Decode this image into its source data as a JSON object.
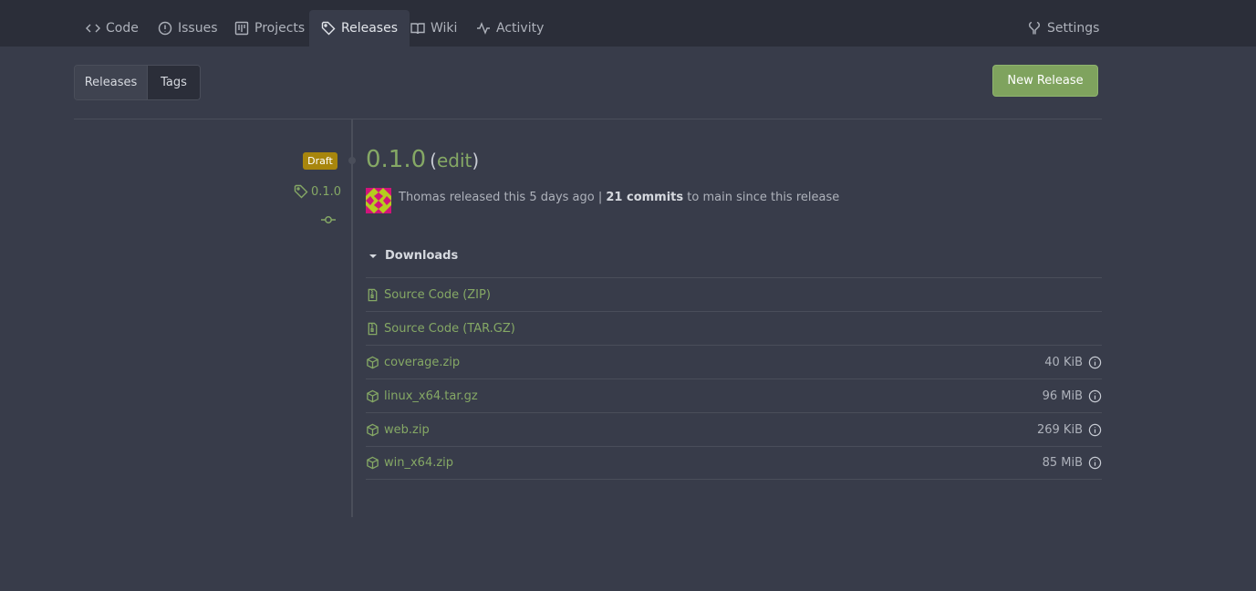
{
  "nav": {
    "tabs": [
      {
        "label": "Code",
        "icon": "code-icon"
      },
      {
        "label": "Issues",
        "icon": "issue-icon"
      },
      {
        "label": "Projects",
        "icon": "project-icon"
      },
      {
        "label": "Releases",
        "icon": "tag-icon",
        "active": true
      },
      {
        "label": "Wiki",
        "icon": "book-icon"
      },
      {
        "label": "Activity",
        "icon": "pulse-icon"
      }
    ],
    "settings_label": "Settings"
  },
  "segment": {
    "releases_label": "Releases",
    "tags_label": "Tags"
  },
  "new_release_label": "New Release",
  "release": {
    "badge": "Draft",
    "tag": "0.1.0",
    "title": "0.1.0",
    "edit_label": "edit",
    "author": "Thomas",
    "released_text": "released this 5 days ago |",
    "commits_count": "21 commits",
    "commits_suffix": "to main since this release"
  },
  "downloads": {
    "label": "Downloads",
    "items": [
      {
        "name": "Source Code (ZIP)",
        "icon": "file-zip-icon",
        "size": ""
      },
      {
        "name": "Source Code (TAR.GZ)",
        "icon": "file-zip-icon",
        "size": ""
      },
      {
        "name": "coverage.zip",
        "icon": "package-icon",
        "size": "40 KiB"
      },
      {
        "name": "linux_x64.tar.gz",
        "icon": "package-icon",
        "size": "96 MiB"
      },
      {
        "name": "web.zip",
        "icon": "package-icon",
        "size": "269 KiB"
      },
      {
        "name": "win_x64.zip",
        "icon": "package-icon",
        "size": "85 MiB"
      }
    ]
  },
  "colors": {
    "accent": "#85a865",
    "button": "#7fa35e",
    "draft": "#a8860d",
    "background": "#383c4a",
    "navbar": "#2b2e39"
  }
}
